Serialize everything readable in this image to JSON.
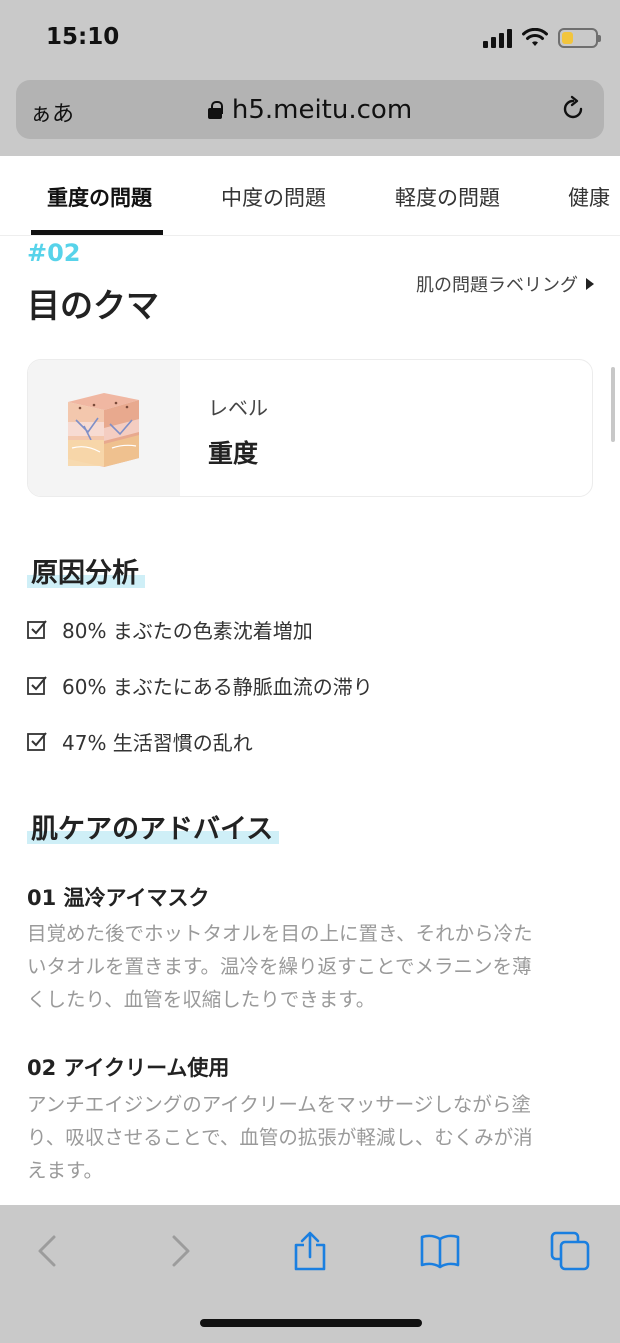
{
  "status_bar": {
    "time": "15:10",
    "battery_color": "#f2c53d"
  },
  "browser": {
    "text_size_label": "ぁあ",
    "url": "h5.meitu.com"
  },
  "tabs": [
    {
      "label": "重度の問題",
      "active": true
    },
    {
      "label": "中度の問題",
      "active": false
    },
    {
      "label": "軽度の問題",
      "active": false
    },
    {
      "label": "健康",
      "active": false
    }
  ],
  "issue": {
    "number": "#02",
    "title": "目のクマ",
    "labeling_link": "肌の問題ラベリング",
    "level_label": "レベル",
    "level_value": "重度"
  },
  "cause_section": {
    "title": "原因分析",
    "items": [
      "80% まぶたの色素沈着増加",
      "60% まぶたにある静脈血流の滞り",
      "47% 生活習慣の乱れ"
    ]
  },
  "advice_section": {
    "title": "肌ケアのアドバイス",
    "items": [
      {
        "title": "01 温冷アイマスク",
        "lines": [
          "目覚めた後でホットタオルを目の上に置き、それから冷た",
          "いタオルを置きます。温冷を繰り返すことでメラニンを薄",
          "くしたり、血管を収縮したりできます。"
        ]
      },
      {
        "title": "02 アイクリーム使用",
        "lines": [
          "アンチエイジングのアイクリームをマッサージしながら塗",
          "り、吸収させることで、血管の拡張が軽減し、むくみが消",
          "えます。"
        ]
      }
    ]
  },
  "colors": {
    "accent": "#57d3ea",
    "highlight": "#cfeff7",
    "safari_blue": "#1a7fe0"
  },
  "toolbar_icons": [
    "back-icon",
    "forward-icon",
    "share-icon",
    "bookmarks-icon",
    "tabs-icon"
  ]
}
